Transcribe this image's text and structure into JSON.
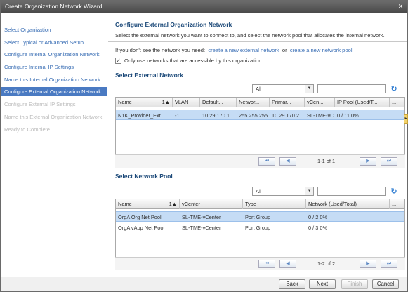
{
  "window": {
    "title": "Create Organization Network Wizard",
    "close_label": "✕"
  },
  "steps": [
    {
      "label": "Select Organization",
      "state": "link"
    },
    {
      "label": "Select Typical or Advanced Setup",
      "state": "link"
    },
    {
      "label": "Configure Internal Organization Network",
      "state": "link"
    },
    {
      "label": "Configure Internal IP Settings",
      "state": "link"
    },
    {
      "label": "Name this Internal Organization Network",
      "state": "link"
    },
    {
      "label": "Configure External Organization Network",
      "state": "active"
    },
    {
      "label": "Configure External IP Settings",
      "state": "disabled"
    },
    {
      "label": "Name this External Organization Network",
      "state": "disabled"
    },
    {
      "label": "Ready to Complete",
      "state": "disabled"
    }
  ],
  "main": {
    "heading": "Configure External Organization Network",
    "description": "Select the external network you want to connect to, and select the network pool that allocates the internal network.",
    "info_prefix": "If you don't see the network you need:",
    "link_create_external": "create a new external network",
    "info_or": "or",
    "link_create_pool": "create a new network pool",
    "only_accessible_label": "Only use networks that are accessible by this organization.",
    "only_accessible_checked": true
  },
  "external": {
    "heading": "Select External Network",
    "filter_value": "All",
    "columns": [
      "Name",
      "VLAN",
      "Default...",
      "Networ...",
      "Primar...",
      "vCen...",
      "IP Pool (Used/T...",
      "..."
    ],
    "rows": [
      [
        "N1K_Provider_Ext",
        "-1",
        "10.29.170.1",
        "255.255.255",
        "10.29.170.2",
        "SL-TME-vC",
        "0 / 11 0%",
        ""
      ]
    ],
    "page_info": "1-1 of 1"
  },
  "pool": {
    "heading": "Select Network Pool",
    "filter_value": "All",
    "columns": [
      "Name",
      "vCenter",
      "Type",
      "Network (Used/Total)",
      "..."
    ],
    "rows": [
      [
        "OrgA Org Net Pool",
        "SL-TME-vCenter",
        "Port Group",
        "0 / 2 0%",
        ""
      ],
      [
        "OrgA vApp Net Pool",
        "SL-TME-vCenter",
        "Port Group",
        "0 / 3 0%",
        ""
      ]
    ],
    "page_info": "1-2 of 2"
  },
  "footer": {
    "back": "Back",
    "next": "Next",
    "finish": "Finish",
    "cancel": "Cancel"
  },
  "icons": {
    "refresh": "refresh-icon",
    "sort": "sort-asc-icon",
    "first": "first-page-icon",
    "prev": "prev-page-icon",
    "next": "next-page-icon",
    "last": "last-page-icon",
    "dropdown": "chevron-down-icon"
  },
  "colors": {
    "active_step": "#4a7ac2",
    "link": "#3b6fb5",
    "heading": "#1e4b7a",
    "selected_row": "#c5dcf5",
    "titlebar": "#5a5a5a"
  }
}
